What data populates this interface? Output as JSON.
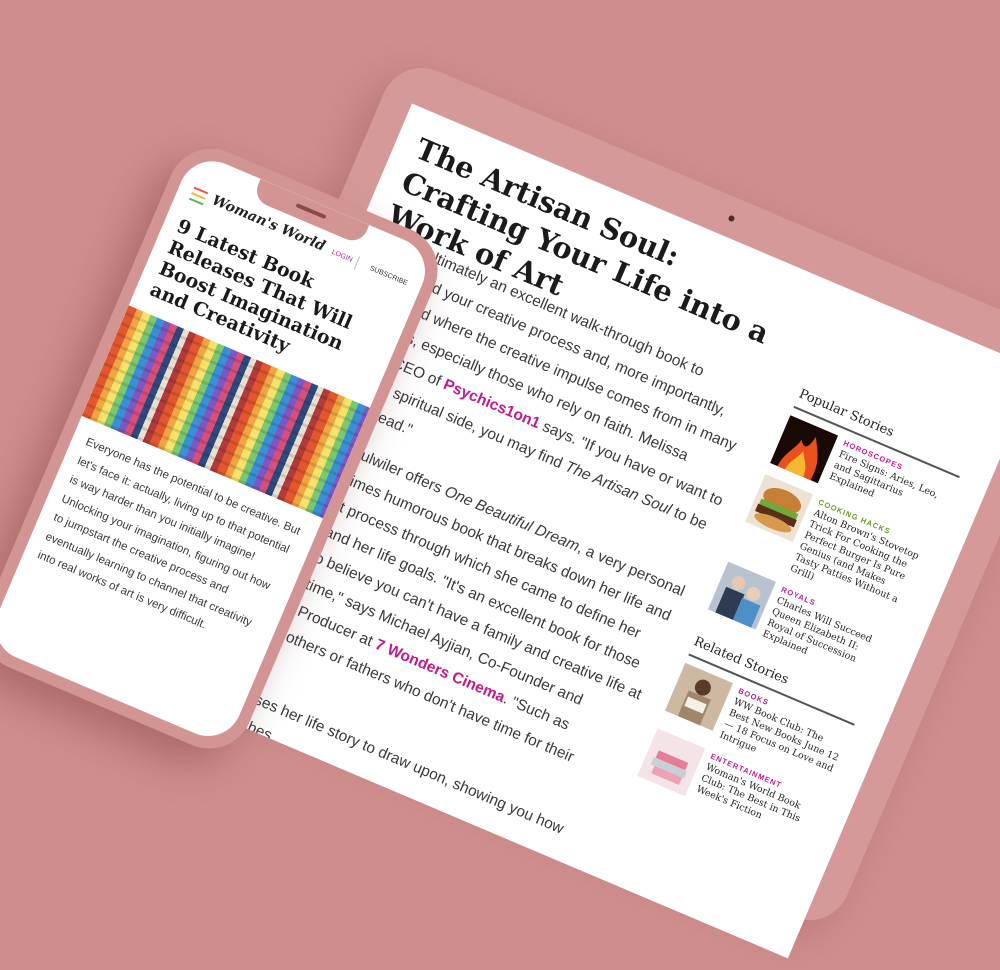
{
  "tablet": {
    "article": {
      "title": "The Artisan Soul: Crafting Your Life into a Work of Art",
      "p1_a": "But it's ultimately an excellent walk-through book to understand your creative process and, more importantly, understand where the creative impulse comes from in many individuals, especially those who rely on faith. Melissa Rhodes, CEO of ",
      "p1_link": "Psychics1on1",
      "p1_b": " says. \"If you have or want to cultivate a spiritual side, you may find ",
      "p1_em": "The Artisan Soul",
      "p1_c": " to be a perfect read.\"",
      "p2_a": "Jennifer Fulwiler offers ",
      "p2_em": "One Beautiful Dream",
      "p2_b": ", a very personal and oftentimes humorous book that breaks down her life and the difficult process through which she came to define her creativity and her life goals. \"It's an excellent book for those of you who believe you can't have a family and creative life at the same time,\" says Michael Ayjian, Co-Founder and Executive Producer at ",
      "p2_link": "7 Wonders Cinema",
      "p2_c": ". \"Such as working mothers or fathers who don't have time for their plates!\"",
      "p3": "Fulwiler uses her life story to draw upon, showing you how she describes"
    },
    "popular": {
      "heading": "Popular Stories",
      "items": [
        {
          "category": "HOROSCOPES",
          "color": "#c2198c",
          "title": "Fire Signs: Aries, Leo, and Sagittarius Explained"
        },
        {
          "category": "COOKING HACKS",
          "color": "#6a9a1f",
          "title": "Alton Brown's Stovetop Trick For Cooking the Perfect Burger Is Pure Genius (and Makes Tasty Patties Without a Grill)"
        },
        {
          "category": "ROYALS",
          "color": "#c2198c",
          "title": "Charles Will Succeed Queen Elizabeth II: Royal of Succession Explained"
        }
      ]
    },
    "related": {
      "heading": "Related Stories",
      "items": [
        {
          "category": "BOOKS",
          "color": "#c2198c",
          "title": "WW Book Club: The Best New Books June 12 — 18 Focus on Love and Intrigue"
        },
        {
          "category": "ENTERTAINMENT",
          "color": "#c2198c",
          "title": "Woman's World Book Club: The Best in This Week's Fiction"
        }
      ]
    }
  },
  "phone": {
    "logo": "Woman's World",
    "login": "LOGIN",
    "subscribe": "SUBSCRIBE",
    "menu_colors": [
      "#e94e3c",
      "#f4b53f",
      "#5bb85d"
    ],
    "title": "9 Latest Book Releases That Will Boost Imagination and Creativity",
    "body": "Everyone has the potential to be creative. But let's face it: actually, living up to that potential is way harder than you initially imagine! Unlocking your imagination, figuring out how to jumpstart the creative process and eventually learning to channel that creativity into real works of art is very difficult."
  }
}
